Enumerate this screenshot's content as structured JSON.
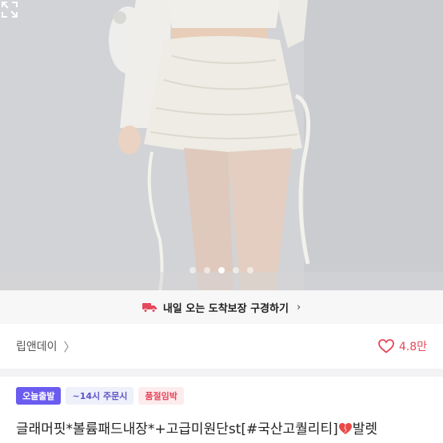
{
  "hero": {
    "image": "product-photo-white-knit-shirring-mini-skirt",
    "page_dots": 5,
    "active_dot": 2
  },
  "delivery": {
    "icon": "truck-icon",
    "text": "내일 오는 도착보장 구경하기",
    "chevron": "›"
  },
  "shop": {
    "name": "립앤데이",
    "chevron": "〉",
    "like_icon": "heart-outline-icon",
    "like_count": "4.8만"
  },
  "badges": [
    {
      "label": "오늘출발"
    },
    {
      "label": "~14시 주문시"
    },
    {
      "label": "품절임박"
    }
  ],
  "product": {
    "title_before": "글래머핏*볼륨패드내장*+고급미원단st[#국산고퀄리티]",
    "title_after": "발렛"
  },
  "colors": {
    "accent_purple": "#6b5cf0",
    "like_red": "#e5485b",
    "delivery_red": "#e5485b"
  }
}
